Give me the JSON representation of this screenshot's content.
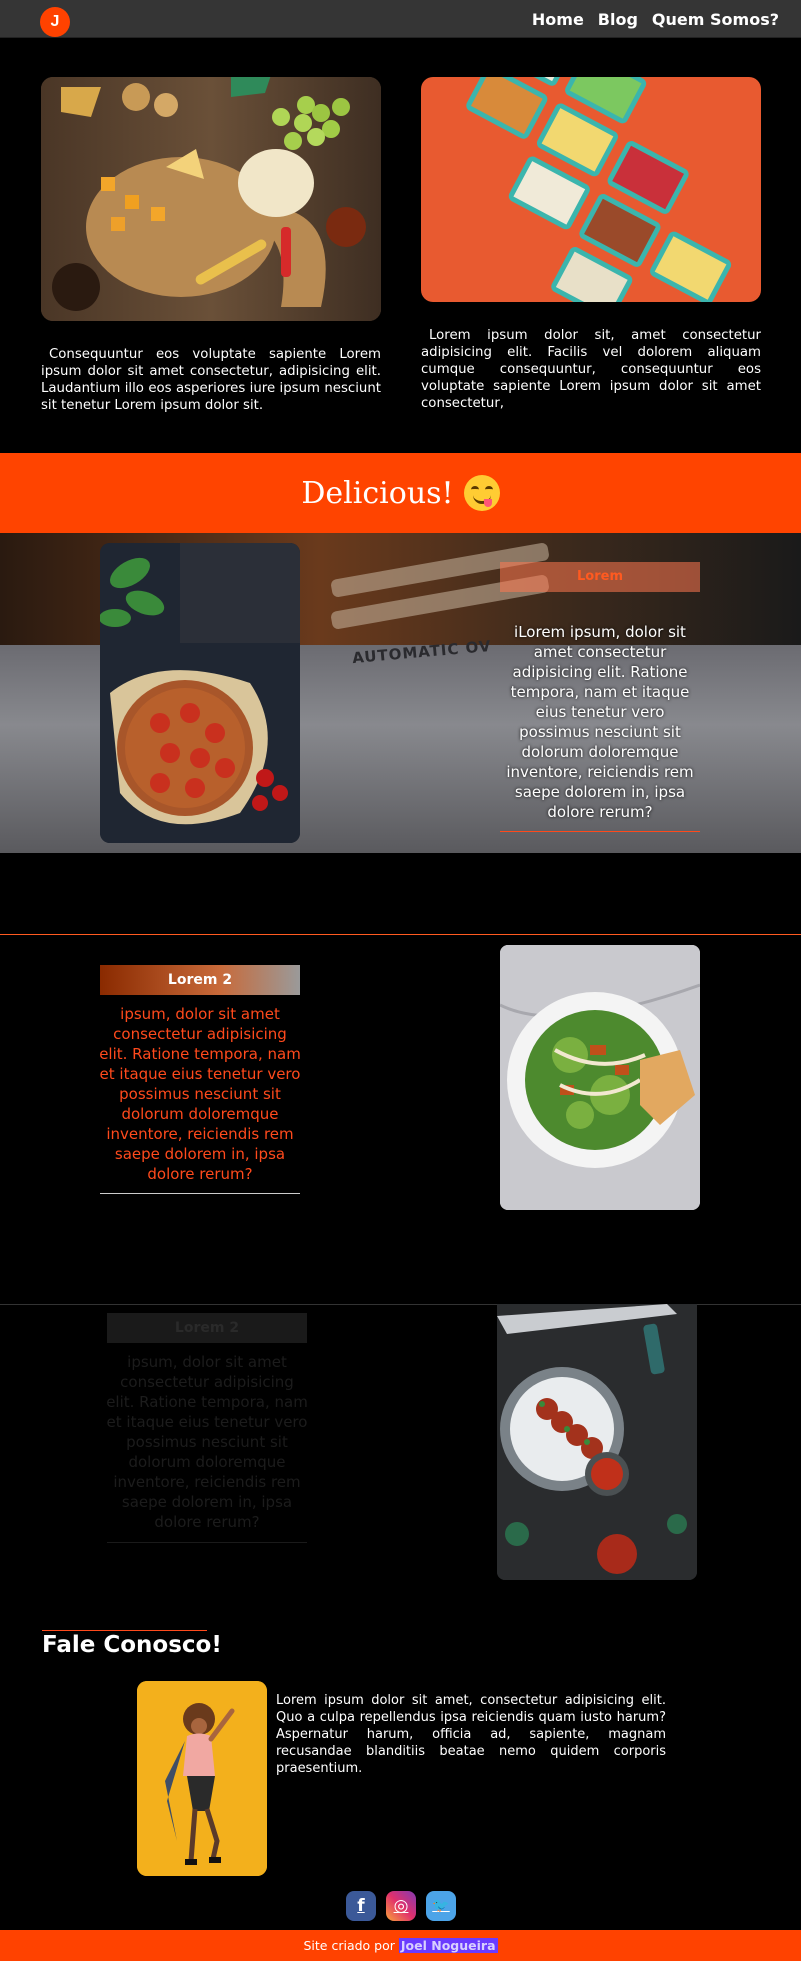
{
  "header": {
    "logo_letter": "J",
    "nav": [
      "Home",
      "Blog",
      "Quem Somos?"
    ]
  },
  "intro": {
    "left_text": "Consequuntur eos voluptate sapiente Lorem ipsum dolor sit amet consectetur, adipisicing elit. Laudantium illo eos asperiores iure ipsum nesciunt sit tenetur Lorem ipsum dolor sit.",
    "right_text": "Lorem ipsum dolor sit, amet consectetur adipisicing elit. Facilis vel dolorem aliquam cumque consequuntur, consequuntur eos voluptate sapiente Lorem ipsum dolor sit amet consectetur,"
  },
  "banner": {
    "title": "Delicious!",
    "emoji": "yum-face"
  },
  "hero": {
    "oven_text": "AUTOMATIC OV",
    "note_title": "Lorem",
    "note_body": "iLorem ipsum, dolor sit amet consectetur adipisicing elit. Ratione tempora, nam et itaque eius tenetur vero possimus nesciunt sit dolorum doloremque inventore, reiciendis rem saepe dolorem in, ipsa dolore rerum?"
  },
  "feature": {
    "title": "Lorem 2",
    "body": "ipsum, dolor sit amet consectetur adipisicing elit. Ratione tempora, nam et itaque eius tenetur vero possimus nesciunt sit dolorum doloremque inventore, reiciendis rem saepe dolorem in, ipsa dolore rerum?"
  },
  "faded": {
    "title": "Lorem 2",
    "body": "ipsum, dolor sit amet consectetur adipisicing elit. Ratione tempora, nam et itaque eius tenetur vero possimus nesciunt sit dolorum doloremque inventore, reiciendis rem saepe dolorem in, ipsa dolore rerum?"
  },
  "contact": {
    "title": "Fale Conosco!",
    "text": "Lorem ipsum dolor sit amet, consectetur adipisicing elit. Quo a culpa repellendus ipsa reiciendis quam iusto harum? Aspernatur harum, officia ad, sapiente, magnam recusandae blanditiis beatae nemo quidem corporis praesentium."
  },
  "social": {
    "facebook_glyph": "f",
    "instagram_glyph": "◎",
    "twitter_glyph": "🐦"
  },
  "footer": {
    "text": "Site criado por",
    "author": "Joel Nogueira"
  },
  "colors": {
    "accent": "#ff4400",
    "background": "#000000",
    "header": "#353535"
  }
}
